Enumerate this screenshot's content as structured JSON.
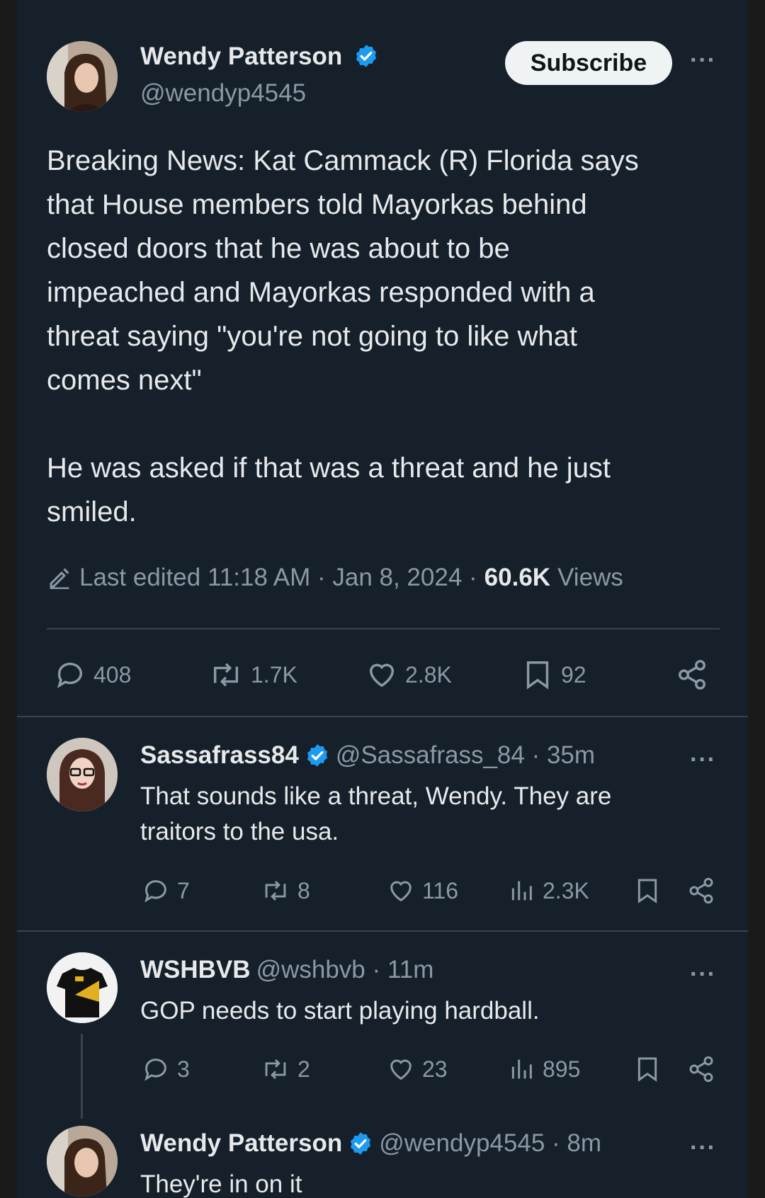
{
  "main_tweet": {
    "author_name": "Wendy Patterson",
    "handle": "@wendyp4545",
    "subscribe_label": "Subscribe",
    "more_label": "···",
    "text": "Breaking News: Kat Cammack (R) Florida says\nthat House members told Mayorkas behind\nclosed doors that he was about to be\nimpeached and Mayorkas responded with a\nthreat saying \"you're not going to like what\ncomes next\"\n\nHe was asked if that was a threat and he just\nsmiled.",
    "edited_prefix": "Last edited 11:18 AM · Jan 8, 2024 ·",
    "views_count": "60.6K",
    "views_label": "Views",
    "stats": {
      "replies": "408",
      "reposts": "1.7K",
      "likes": "2.8K",
      "bookmarks": "92"
    },
    "icon_names": [
      "pencil-icon",
      "reply-icon",
      "repost-icon",
      "like-icon",
      "bookmark-icon",
      "share-icon"
    ]
  },
  "replies": [
    {
      "author_name": "Sassafrass84",
      "handle_time": "@Sassafrass_84 · 35m",
      "text": "That sounds like a threat, Wendy. They are traitors to the usa.",
      "stats": {
        "replies": "7",
        "reposts": "8",
        "likes": "116",
        "views": "2.3K"
      },
      "verified": true
    },
    {
      "author_name": "WSHBVB",
      "handle_time": "@wshbvb · 11m",
      "text": "GOP needs to start playing hardball.",
      "stats": {
        "replies": "3",
        "reposts": "2",
        "likes": "23",
        "views": "895"
      },
      "verified": false
    },
    {
      "author_name": "Wendy Patterson",
      "handle_time": "@wendyp4545 · 8m",
      "text": "They're in on it",
      "verified": true
    }
  ],
  "colors": {
    "background": "#15202b",
    "muted": "#8b98a5",
    "verified": "#1d9bf0",
    "divider": "#38444d"
  }
}
